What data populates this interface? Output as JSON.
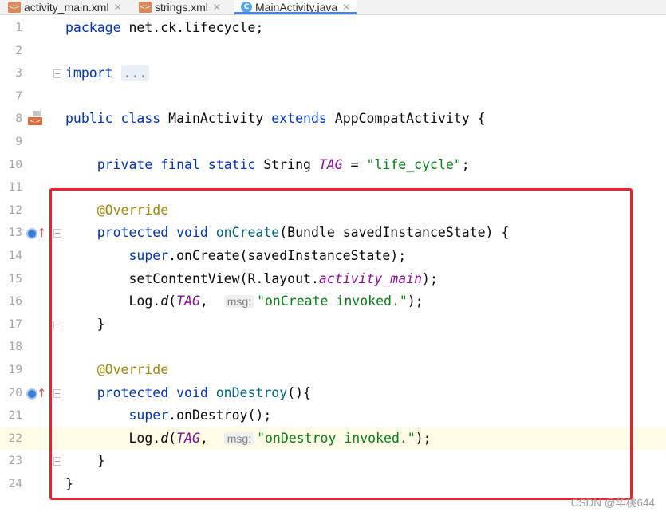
{
  "tabs": [
    {
      "label": "activity_main.xml",
      "icon": "xml-file-icon",
      "active": false
    },
    {
      "label": "strings.xml",
      "icon": "xml-file-icon",
      "active": false
    },
    {
      "label": "MainActivity.java",
      "icon": "java-class-icon",
      "icon_glyph": "C",
      "active": true
    }
  ],
  "tab_close_glyph": "✕",
  "lines": [
    {
      "n": "1",
      "tokens": [
        {
          "t": "package ",
          "c": "kw"
        },
        {
          "t": "net.ck.lifecycle;",
          "c": ""
        }
      ]
    },
    {
      "n": "2",
      "tokens": []
    },
    {
      "n": "3",
      "tokens": [
        {
          "t": "import ",
          "c": "kw"
        },
        {
          "t": "...",
          "c": "folded"
        }
      ]
    },
    {
      "n": "7",
      "tokens": []
    },
    {
      "n": "8",
      "tokens": [
        {
          "t": "public ",
          "c": "kw"
        },
        {
          "t": "class ",
          "c": "kw"
        },
        {
          "t": "MainActivity ",
          "c": ""
        },
        {
          "t": "extends ",
          "c": "kw"
        },
        {
          "t": "AppCompatActivity {",
          "c": ""
        }
      ]
    },
    {
      "n": "9",
      "tokens": []
    },
    {
      "n": "10",
      "tokens": [
        {
          "t": "    private ",
          "c": "kw"
        },
        {
          "t": "final ",
          "c": "kw"
        },
        {
          "t": "static ",
          "c": "kw"
        },
        {
          "t": "String ",
          "c": ""
        },
        {
          "t": "TAG",
          "c": "const"
        },
        {
          "t": " = ",
          "c": ""
        },
        {
          "t": "\"life_cycle\"",
          "c": "str"
        },
        {
          "t": ";",
          "c": ""
        }
      ]
    },
    {
      "n": "11",
      "tokens": []
    },
    {
      "n": "12",
      "tokens": [
        {
          "t": "    @Override",
          "c": "ann"
        }
      ]
    },
    {
      "n": "13",
      "tokens": [
        {
          "t": "    protected ",
          "c": "kw"
        },
        {
          "t": "void ",
          "c": "kw"
        },
        {
          "t": "onCreate",
          "c": "method"
        },
        {
          "t": "(Bundle savedInstanceState) {",
          "c": ""
        }
      ]
    },
    {
      "n": "14",
      "tokens": [
        {
          "t": "        super",
          "c": "kw"
        },
        {
          "t": ".onCreate(savedInstanceState);",
          "c": ""
        }
      ]
    },
    {
      "n": "15",
      "tokens": [
        {
          "t": "        setContentView(R.layout.",
          "c": ""
        },
        {
          "t": "activity_main",
          "c": "const"
        },
        {
          "t": ");",
          "c": ""
        }
      ]
    },
    {
      "n": "16",
      "tokens": [
        {
          "t": "        Log.",
          "c": ""
        },
        {
          "t": "d",
          "c": "stat"
        },
        {
          "t": "(",
          "c": ""
        },
        {
          "t": "TAG",
          "c": "const"
        },
        {
          "t": ",  ",
          "c": ""
        },
        {
          "t": "msg:",
          "c": "hint"
        },
        {
          "t": "\"onCreate invoked.\"",
          "c": "str"
        },
        {
          "t": ");",
          "c": ""
        }
      ]
    },
    {
      "n": "17",
      "tokens": [
        {
          "t": "    }",
          "c": ""
        }
      ]
    },
    {
      "n": "18",
      "tokens": []
    },
    {
      "n": "19",
      "tokens": [
        {
          "t": "    @Override",
          "c": "ann"
        }
      ]
    },
    {
      "n": "20",
      "tokens": [
        {
          "t": "    protected ",
          "c": "kw"
        },
        {
          "t": "void ",
          "c": "kw"
        },
        {
          "t": "onDestroy",
          "c": "method"
        },
        {
          "t": "(){",
          "c": ""
        }
      ]
    },
    {
      "n": "21",
      "tokens": [
        {
          "t": "        super",
          "c": "kw"
        },
        {
          "t": ".onDestroy();",
          "c": ""
        }
      ]
    },
    {
      "n": "22",
      "tokens": [
        {
          "t": "        Log.",
          "c": ""
        },
        {
          "t": "d",
          "c": "stat"
        },
        {
          "t": "(",
          "c": ""
        },
        {
          "t": "TAG",
          "c": "const"
        },
        {
          "t": ",  ",
          "c": ""
        },
        {
          "t": "msg:",
          "c": "hint"
        },
        {
          "t": "\"onDestroy invoked.\"",
          "c": "str"
        },
        {
          "t": ");",
          "c": ""
        }
      ],
      "current": true
    },
    {
      "n": "23",
      "tokens": [
        {
          "t": "    }",
          "c": ""
        }
      ]
    },
    {
      "n": "24",
      "tokens": [
        {
          "t": "}",
          "c": ""
        }
      ]
    }
  ],
  "gutter_icons": [
    {
      "line": "8",
      "icon": "class-gutter-icon",
      "glyph": "<>"
    },
    {
      "line": "13",
      "icon": "overrides-method-icon",
      "glyph": "↑"
    },
    {
      "line": "20",
      "icon": "overrides-method-icon",
      "glyph": "↑"
    }
  ],
  "fold_markers": [
    "3",
    "13",
    "17",
    "20",
    "23"
  ],
  "watermark": "CSDN @华桃644",
  "colors": {
    "keyword": "#0033b3",
    "annotation": "#9e880d",
    "string": "#067d17",
    "constant": "#871094",
    "method_decl": "#00627a",
    "highlight_box": "#e8232b",
    "current_line": "#fefbe6"
  }
}
